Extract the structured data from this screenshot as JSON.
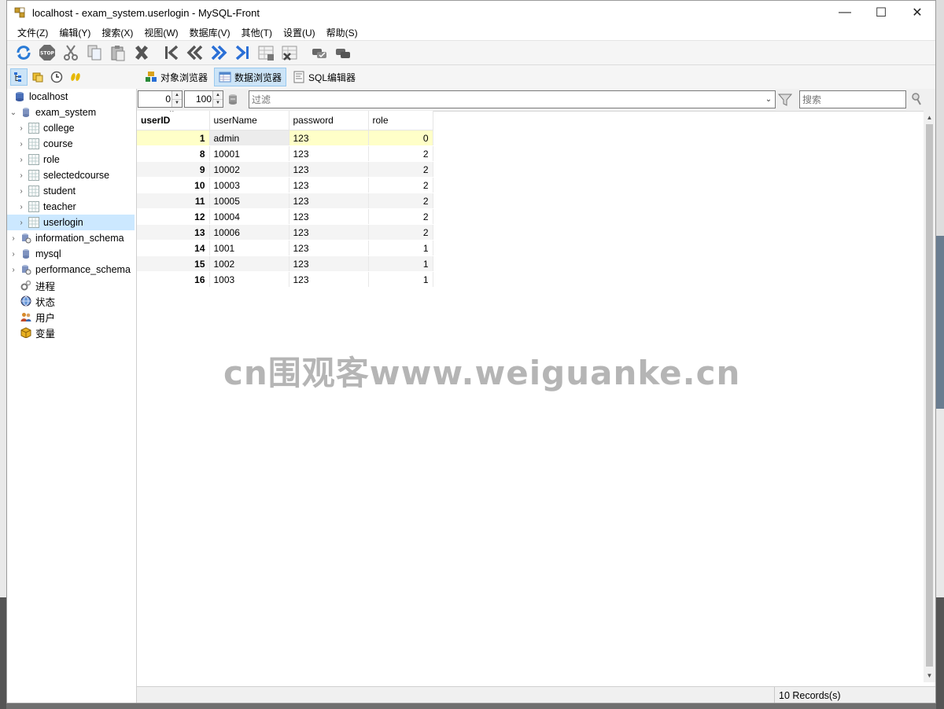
{
  "window": {
    "title": "localhost - exam_system.userlogin - MySQL-Front",
    "controls": {
      "minimize": "—",
      "maximize": "☐",
      "close": "✕"
    }
  },
  "menu": [
    "文件(Z)",
    "编辑(Y)",
    "搜索(X)",
    "视图(W)",
    "数据库(V)",
    "其他(T)",
    "设置(U)",
    "帮助(S)"
  ],
  "view_tabs": [
    {
      "label": "对象浏览器",
      "icon": "objects-icon",
      "active": false
    },
    {
      "label": "数据浏览器",
      "icon": "data-browser-icon",
      "active": true
    },
    {
      "label": "SQL编辑器",
      "icon": "sql-editor-icon",
      "active": false
    }
  ],
  "tree": {
    "root": "localhost",
    "database": "exam_system",
    "tables": [
      "college",
      "course",
      "role",
      "selectedcourse",
      "student",
      "teacher",
      "userlogin"
    ],
    "selected_table": "userlogin",
    "other_databases": [
      "information_schema",
      "mysql",
      "performance_schema"
    ],
    "misc": [
      "进程",
      "状态",
      "用户",
      "变量"
    ]
  },
  "filterbar": {
    "offset": "0",
    "limit": "100",
    "filter_placeholder": "过滤",
    "search_placeholder": "搜索"
  },
  "grid": {
    "columns": [
      "userID",
      "userName",
      "password",
      "role"
    ],
    "rows": [
      [
        "1",
        "admin",
        "123",
        "0"
      ],
      [
        "8",
        "10001",
        "123",
        "2"
      ],
      [
        "9",
        "10002",
        "123",
        "2"
      ],
      [
        "10",
        "10003",
        "123",
        "2"
      ],
      [
        "11",
        "10005",
        "123",
        "2"
      ],
      [
        "12",
        "10004",
        "123",
        "2"
      ],
      [
        "13",
        "10006",
        "123",
        "2"
      ],
      [
        "14",
        "1001",
        "123",
        "1"
      ],
      [
        "15",
        "1002",
        "123",
        "1"
      ],
      [
        "16",
        "1003",
        "123",
        "1"
      ]
    ]
  },
  "watermark": "cn围观客www.weiguanke.cn",
  "status": {
    "records": "10 Records(s)"
  },
  "colors": {
    "selection": "#cce8ff",
    "active_row": "#ffffc8",
    "accent": "#2f6fd6"
  }
}
